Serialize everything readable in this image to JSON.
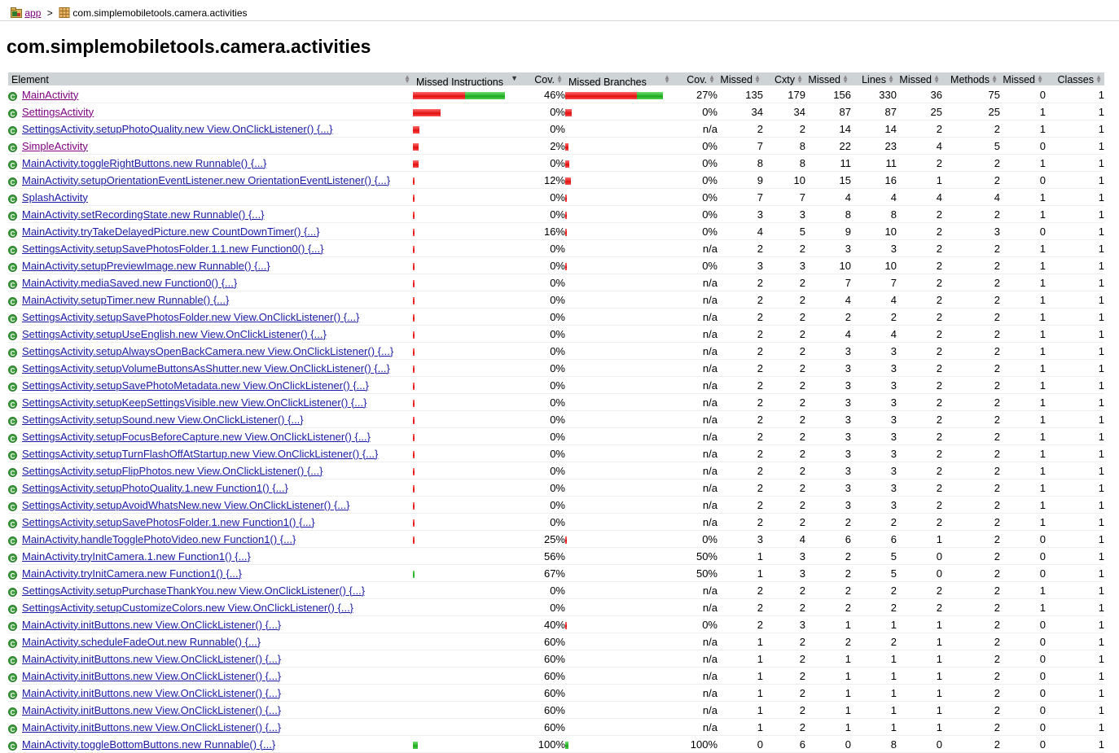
{
  "breadcrumb": {
    "app": "app",
    "separator": ">",
    "package": "com.simplemobiletools.camera.activities"
  },
  "page_title": "com.simplemobiletools.camera.activities",
  "headers": [
    "Element",
    "Missed Instructions",
    "Cov.",
    "Missed Branches",
    "Cov.",
    "Missed",
    "Cxty",
    "Missed",
    "Lines",
    "Missed",
    "Methods",
    "Missed",
    "Classes"
  ],
  "colors": {
    "bar_red": "#e01010",
    "bar_green": "#1fa81f",
    "header_bg": "#ced3d6",
    "link": "#1a1aa6",
    "visited_link": "#800080"
  },
  "rows": [
    {
      "name": "MainActivity",
      "ir": 0.53,
      "ig": 0.41,
      "icov": "46%",
      "br": 0.73,
      "bg": 0.27,
      "bcov": "27%",
      "mc": "135",
      "cx": "179",
      "ml": "156",
      "li": "330",
      "mm": "36",
      "me": "75",
      "mcl": "0",
      "cl": "1",
      "visited": true
    },
    {
      "name": "SettingsActivity",
      "ir": 0.28,
      "ig": 0,
      "icov": "0%",
      "br": 0.07,
      "bg": 0,
      "bcov": "0%",
      "mc": "34",
      "cx": "34",
      "ml": "87",
      "li": "87",
      "mm": "25",
      "me": "25",
      "mcl": "1",
      "cl": "1",
      "visited": true
    },
    {
      "name": "SettingsActivity.setupPhotoQuality.new View.OnClickListener() {...}",
      "ir": 0.07,
      "ig": 0,
      "icov": "0%",
      "br": 0,
      "bg": 0,
      "bcov": "n/a",
      "mc": "2",
      "cx": "2",
      "ml": "14",
      "li": "14",
      "mm": "2",
      "me": "2",
      "mcl": "1",
      "cl": "1"
    },
    {
      "name": "SimpleActivity",
      "ir": 0.06,
      "ig": 0,
      "icov": "2%",
      "br": 0.03,
      "bg": 0,
      "bcov": "0%",
      "mc": "7",
      "cx": "8",
      "ml": "22",
      "li": "23",
      "mm": "4",
      "me": "5",
      "mcl": "0",
      "cl": "1",
      "visited": true
    },
    {
      "name": "MainActivity.toggleRightButtons.new Runnable() {...}",
      "ir": 0.06,
      "ig": 0,
      "icov": "0%",
      "br": 0.04,
      "bg": 0,
      "bcov": "0%",
      "mc": "8",
      "cx": "8",
      "ml": "11",
      "li": "11",
      "mm": "2",
      "me": "2",
      "mcl": "1",
      "cl": "1"
    },
    {
      "name": "MainActivity.setupOrientationEventListener.new OrientationEventListener() {...}",
      "ir": 0.02,
      "ig": 0,
      "icov": "12%",
      "br": 0.06,
      "bg": 0,
      "bcov": "0%",
      "mc": "9",
      "cx": "10",
      "ml": "15",
      "li": "16",
      "mm": "1",
      "me": "2",
      "mcl": "0",
      "cl": "1"
    },
    {
      "name": "SplashActivity",
      "ir": 0.02,
      "ig": 0,
      "icov": "0%",
      "br": 0.02,
      "bg": 0,
      "bcov": "0%",
      "mc": "7",
      "cx": "7",
      "ml": "4",
      "li": "4",
      "mm": "4",
      "me": "4",
      "mcl": "1",
      "cl": "1"
    },
    {
      "name": "MainActivity.setRecordingState.new Runnable() {...}",
      "ir": 0.015,
      "ig": 0,
      "icov": "0%",
      "br": 0.01,
      "bg": 0,
      "bcov": "0%",
      "mc": "3",
      "cx": "3",
      "ml": "8",
      "li": "8",
      "mm": "2",
      "me": "2",
      "mcl": "1",
      "cl": "1"
    },
    {
      "name": "MainActivity.tryTakeDelayedPicture.new CountDownTimer() {...}",
      "ir": 0.015,
      "ig": 0,
      "icov": "16%",
      "br": 0.015,
      "bg": 0,
      "bcov": "0%",
      "mc": "4",
      "cx": "5",
      "ml": "9",
      "li": "10",
      "mm": "2",
      "me": "3",
      "mcl": "0",
      "cl": "1"
    },
    {
      "name": "SettingsActivity.setupSavePhotosFolder.1.1.new Function0() {...}",
      "ir": 0.015,
      "ig": 0,
      "icov": "0%",
      "br": 0,
      "bg": 0,
      "bcov": "n/a",
      "mc": "2",
      "cx": "2",
      "ml": "3",
      "li": "3",
      "mm": "2",
      "me": "2",
      "mcl": "1",
      "cl": "1"
    },
    {
      "name": "MainActivity.setupPreviewImage.new Runnable() {...}",
      "ir": 0.015,
      "ig": 0,
      "icov": "0%",
      "br": 0.01,
      "bg": 0,
      "bcov": "0%",
      "mc": "3",
      "cx": "3",
      "ml": "10",
      "li": "10",
      "mm": "2",
      "me": "2",
      "mcl": "1",
      "cl": "1"
    },
    {
      "name": "MainActivity.mediaSaved.new Function0() {...}",
      "ir": 0.015,
      "ig": 0,
      "icov": "0%",
      "br": 0,
      "bg": 0,
      "bcov": "n/a",
      "mc": "2",
      "cx": "2",
      "ml": "7",
      "li": "7",
      "mm": "2",
      "me": "2",
      "mcl": "1",
      "cl": "1"
    },
    {
      "name": "MainActivity.setupTimer.new Runnable() {...}",
      "ir": 0.015,
      "ig": 0,
      "icov": "0%",
      "br": 0,
      "bg": 0,
      "bcov": "n/a",
      "mc": "2",
      "cx": "2",
      "ml": "4",
      "li": "4",
      "mm": "2",
      "me": "2",
      "mcl": "1",
      "cl": "1"
    },
    {
      "name": "SettingsActivity.setupSavePhotosFolder.new View.OnClickListener() {...}",
      "ir": 0.01,
      "ig": 0,
      "icov": "0%",
      "br": 0,
      "bg": 0,
      "bcov": "n/a",
      "mc": "2",
      "cx": "2",
      "ml": "2",
      "li": "2",
      "mm": "2",
      "me": "2",
      "mcl": "1",
      "cl": "1"
    },
    {
      "name": "SettingsActivity.setupUseEnglish.new View.OnClickListener() {...}",
      "ir": 0.01,
      "ig": 0,
      "icov": "0%",
      "br": 0,
      "bg": 0,
      "bcov": "n/a",
      "mc": "2",
      "cx": "2",
      "ml": "4",
      "li": "4",
      "mm": "2",
      "me": "2",
      "mcl": "1",
      "cl": "1"
    },
    {
      "name": "SettingsActivity.setupAlwaysOpenBackCamera.new View.OnClickListener() {...}",
      "ir": 0.01,
      "ig": 0,
      "icov": "0%",
      "br": 0,
      "bg": 0,
      "bcov": "n/a",
      "mc": "2",
      "cx": "2",
      "ml": "3",
      "li": "3",
      "mm": "2",
      "me": "2",
      "mcl": "1",
      "cl": "1"
    },
    {
      "name": "SettingsActivity.setupVolumeButtonsAsShutter.new View.OnClickListener() {...}",
      "ir": 0.01,
      "ig": 0,
      "icov": "0%",
      "br": 0,
      "bg": 0,
      "bcov": "n/a",
      "mc": "2",
      "cx": "2",
      "ml": "3",
      "li": "3",
      "mm": "2",
      "me": "2",
      "mcl": "1",
      "cl": "1"
    },
    {
      "name": "SettingsActivity.setupSavePhotoMetadata.new View.OnClickListener() {...}",
      "ir": 0.01,
      "ig": 0,
      "icov": "0%",
      "br": 0,
      "bg": 0,
      "bcov": "n/a",
      "mc": "2",
      "cx": "2",
      "ml": "3",
      "li": "3",
      "mm": "2",
      "me": "2",
      "mcl": "1",
      "cl": "1"
    },
    {
      "name": "SettingsActivity.setupKeepSettingsVisible.new View.OnClickListener() {...}",
      "ir": 0.01,
      "ig": 0,
      "icov": "0%",
      "br": 0,
      "bg": 0,
      "bcov": "n/a",
      "mc": "2",
      "cx": "2",
      "ml": "3",
      "li": "3",
      "mm": "2",
      "me": "2",
      "mcl": "1",
      "cl": "1"
    },
    {
      "name": "SettingsActivity.setupSound.new View.OnClickListener() {...}",
      "ir": 0.01,
      "ig": 0,
      "icov": "0%",
      "br": 0,
      "bg": 0,
      "bcov": "n/a",
      "mc": "2",
      "cx": "2",
      "ml": "3",
      "li": "3",
      "mm": "2",
      "me": "2",
      "mcl": "1",
      "cl": "1"
    },
    {
      "name": "SettingsActivity.setupFocusBeforeCapture.new View.OnClickListener() {...}",
      "ir": 0.01,
      "ig": 0,
      "icov": "0%",
      "br": 0,
      "bg": 0,
      "bcov": "n/a",
      "mc": "2",
      "cx": "2",
      "ml": "3",
      "li": "3",
      "mm": "2",
      "me": "2",
      "mcl": "1",
      "cl": "1"
    },
    {
      "name": "SettingsActivity.setupTurnFlashOffAtStartup.new View.OnClickListener() {...}",
      "ir": 0.01,
      "ig": 0,
      "icov": "0%",
      "br": 0,
      "bg": 0,
      "bcov": "n/a",
      "mc": "2",
      "cx": "2",
      "ml": "3",
      "li": "3",
      "mm": "2",
      "me": "2",
      "mcl": "1",
      "cl": "1"
    },
    {
      "name": "SettingsActivity.setupFlipPhotos.new View.OnClickListener() {...}",
      "ir": 0.01,
      "ig": 0,
      "icov": "0%",
      "br": 0,
      "bg": 0,
      "bcov": "n/a",
      "mc": "2",
      "cx": "2",
      "ml": "3",
      "li": "3",
      "mm": "2",
      "me": "2",
      "mcl": "1",
      "cl": "1"
    },
    {
      "name": "SettingsActivity.setupPhotoQuality.1.new Function1() {...}",
      "ir": 0.01,
      "ig": 0,
      "icov": "0%",
      "br": 0,
      "bg": 0,
      "bcov": "n/a",
      "mc": "2",
      "cx": "2",
      "ml": "3",
      "li": "3",
      "mm": "2",
      "me": "2",
      "mcl": "1",
      "cl": "1"
    },
    {
      "name": "SettingsActivity.setupAvoidWhatsNew.new View.OnClickListener() {...}",
      "ir": 0.01,
      "ig": 0,
      "icov": "0%",
      "br": 0,
      "bg": 0,
      "bcov": "n/a",
      "mc": "2",
      "cx": "2",
      "ml": "3",
      "li": "3",
      "mm": "2",
      "me": "2",
      "mcl": "1",
      "cl": "1"
    },
    {
      "name": "SettingsActivity.setupSavePhotosFolder.1.new Function1() {...}",
      "ir": 0.01,
      "ig": 0,
      "icov": "0%",
      "br": 0,
      "bg": 0,
      "bcov": "n/a",
      "mc": "2",
      "cx": "2",
      "ml": "2",
      "li": "2",
      "mm": "2",
      "me": "2",
      "mcl": "1",
      "cl": "1"
    },
    {
      "name": "MainActivity.handleTogglePhotoVideo.new Function1() {...}",
      "ir": 0.01,
      "ig": 0,
      "icov": "25%",
      "br": 0.015,
      "bg": 0,
      "bcov": "0%",
      "mc": "3",
      "cx": "4",
      "ml": "6",
      "li": "6",
      "mm": "1",
      "me": "2",
      "mcl": "0",
      "cl": "1"
    },
    {
      "name": "MainActivity.tryInitCamera.1.new Function1() {...}",
      "ir": 0,
      "ig": 0,
      "icov": "56%",
      "br": 0,
      "bg": 0,
      "bcov": "50%",
      "mc": "1",
      "cx": "3",
      "ml": "2",
      "li": "5",
      "mm": "0",
      "me": "2",
      "mcl": "0",
      "cl": "1"
    },
    {
      "name": "MainActivity.tryInitCamera.new Function1() {...}",
      "ir": 0,
      "ig": 0.01,
      "icov": "67%",
      "br": 0,
      "bg": 0,
      "bcov": "50%",
      "mc": "1",
      "cx": "3",
      "ml": "2",
      "li": "5",
      "mm": "0",
      "me": "2",
      "mcl": "0",
      "cl": "1"
    },
    {
      "name": "SettingsActivity.setupPurchaseThankYou.new View.OnClickListener() {...}",
      "ir": 0,
      "ig": 0,
      "icov": "0%",
      "br": 0,
      "bg": 0,
      "bcov": "n/a",
      "mc": "2",
      "cx": "2",
      "ml": "2",
      "li": "2",
      "mm": "2",
      "me": "2",
      "mcl": "1",
      "cl": "1"
    },
    {
      "name": "SettingsActivity.setupCustomizeColors.new View.OnClickListener() {...}",
      "ir": 0,
      "ig": 0,
      "icov": "0%",
      "br": 0,
      "bg": 0,
      "bcov": "n/a",
      "mc": "2",
      "cx": "2",
      "ml": "2",
      "li": "2",
      "mm": "2",
      "me": "2",
      "mcl": "1",
      "cl": "1"
    },
    {
      "name": "MainActivity.initButtons.new View.OnClickListener() {...}",
      "ir": 0,
      "ig": 0,
      "icov": "40%",
      "br": 0.01,
      "bg": 0,
      "bcov": "0%",
      "mc": "2",
      "cx": "3",
      "ml": "1",
      "li": "1",
      "mm": "1",
      "me": "2",
      "mcl": "0",
      "cl": "1"
    },
    {
      "name": "MainActivity.scheduleFadeOut.new Runnable() {...}",
      "ir": 0,
      "ig": 0,
      "icov": "60%",
      "br": 0,
      "bg": 0,
      "bcov": "n/a",
      "mc": "1",
      "cx": "2",
      "ml": "2",
      "li": "2",
      "mm": "1",
      "me": "2",
      "mcl": "0",
      "cl": "1"
    },
    {
      "name": "MainActivity.initButtons.new View.OnClickListener() {...}",
      "ir": 0,
      "ig": 0,
      "icov": "60%",
      "br": 0,
      "bg": 0,
      "bcov": "n/a",
      "mc": "1",
      "cx": "2",
      "ml": "1",
      "li": "1",
      "mm": "1",
      "me": "2",
      "mcl": "0",
      "cl": "1"
    },
    {
      "name": "MainActivity.initButtons.new View.OnClickListener() {...}",
      "ir": 0,
      "ig": 0,
      "icov": "60%",
      "br": 0,
      "bg": 0,
      "bcov": "n/a",
      "mc": "1",
      "cx": "2",
      "ml": "1",
      "li": "1",
      "mm": "1",
      "me": "2",
      "mcl": "0",
      "cl": "1"
    },
    {
      "name": "MainActivity.initButtons.new View.OnClickListener() {...}",
      "ir": 0,
      "ig": 0,
      "icov": "60%",
      "br": 0,
      "bg": 0,
      "bcov": "n/a",
      "mc": "1",
      "cx": "2",
      "ml": "1",
      "li": "1",
      "mm": "1",
      "me": "2",
      "mcl": "0",
      "cl": "1"
    },
    {
      "name": "MainActivity.initButtons.new View.OnClickListener() {...}",
      "ir": 0,
      "ig": 0,
      "icov": "60%",
      "br": 0,
      "bg": 0,
      "bcov": "n/a",
      "mc": "1",
      "cx": "2",
      "ml": "1",
      "li": "1",
      "mm": "1",
      "me": "2",
      "mcl": "0",
      "cl": "1"
    },
    {
      "name": "MainActivity.initButtons.new View.OnClickListener() {...}",
      "ir": 0,
      "ig": 0,
      "icov": "60%",
      "br": 0,
      "bg": 0,
      "bcov": "n/a",
      "mc": "1",
      "cx": "2",
      "ml": "1",
      "li": "1",
      "mm": "1",
      "me": "2",
      "mcl": "0",
      "cl": "1"
    },
    {
      "name": "MainActivity.toggleBottomButtons.new Runnable() {...}",
      "ir": 0,
      "ig": 0.05,
      "icov": "100%",
      "br": 0,
      "bg": 0.03,
      "bcov": "100%",
      "mc": "0",
      "cx": "6",
      "ml": "0",
      "li": "8",
      "mm": "0",
      "me": "2",
      "mcl": "0",
      "cl": "1"
    }
  ]
}
